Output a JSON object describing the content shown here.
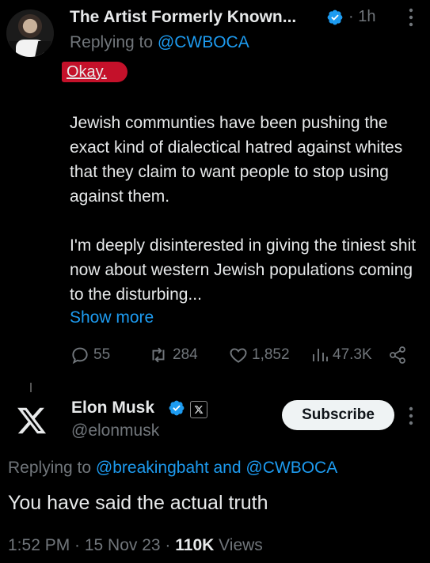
{
  "tweet1": {
    "author": "The Artist Formerly Known...",
    "time": "· 1h",
    "replying_prefix": "Replying to",
    "replying_to": "@CWBOCA",
    "highlighted_text": "Okay.",
    "paragraph1": "Jewish communties have been pushing the exact kind of dialectical hatred against whites that they claim to want people to stop using against them.",
    "paragraph2": "I'm deeply disinterested in giving the tiniest shit now about western Jewish populations coming to the disturbing...",
    "show_more": "Show more",
    "replies": "55",
    "reposts": "284",
    "likes": "1,852",
    "views": "47.3K"
  },
  "tweet2": {
    "name": "Elon Musk",
    "handle": "@elonmusk",
    "subscribe_label": "Subscribe",
    "replying_prefix": "Replying to",
    "replying_to_1": "@breakingbaht",
    "replying_and": "and",
    "replying_to_2": "@CWBOCA",
    "body": "You have said the actual truth",
    "timestamp": "1:52 PM · 15 Nov 23 · ",
    "views_count": "110K",
    "views_label": "Views"
  },
  "colors": {
    "accent": "#1d9bf0",
    "highlight": "#c4112a",
    "background": "#000000",
    "muted": "#71767b"
  }
}
